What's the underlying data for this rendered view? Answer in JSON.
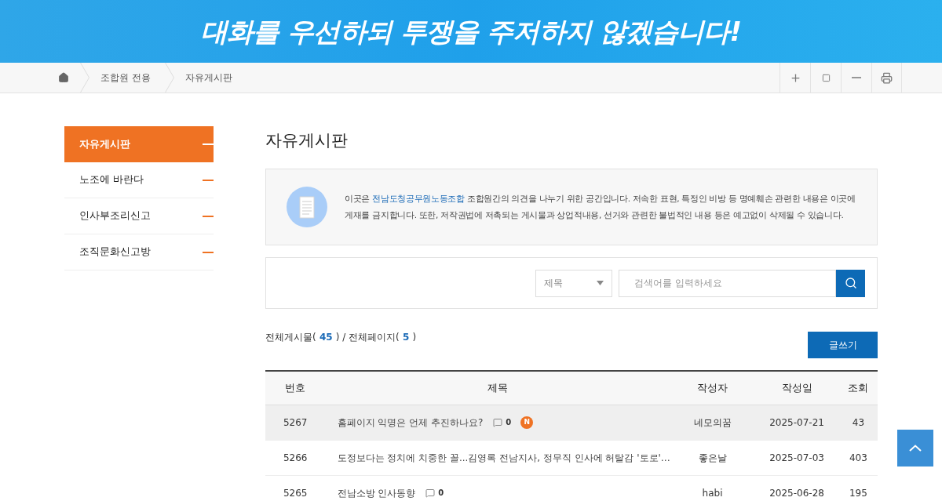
{
  "banner": {
    "slogan": "대화를 우선하되 투쟁을 주저하지 않겠습니다!"
  },
  "breadcrumb": [
    "조합원 전용",
    "자유게시판"
  ],
  "sidebar": {
    "items": [
      {
        "label": "자유게시판",
        "selected": true
      },
      {
        "label": "노조에 바란다",
        "selected": false
      },
      {
        "label": "인사부조리신고",
        "selected": false
      },
      {
        "label": "조직문화신고방",
        "selected": false
      }
    ]
  },
  "page_title": "자유게시판",
  "notice": "이곳은 **전남도청공무원노동조합** 조합원간의 의견을 나누기 위한 공간입니다. 저속한 표현, 특정인 비방 등 명예훼손 관련한 내용은 이곳에 게재를 금지합니다. 또한, 저작권법에 저촉되는 게시물과 상업적내용, 선거와 관련한 불법적인 내용 등은 예고없이 삭제될 수 있습니다.",
  "search": {
    "scope": "제목",
    "placeholder": "검색어를 입력하세요"
  },
  "totals": {
    "posts_label": "전체게시물(",
    "posts": "45",
    "pages_label": ") / 전체페이지(",
    "pages": "5",
    "close": ")"
  },
  "write_button": "글쓰기",
  "table": {
    "columns": [
      "번호",
      "제목",
      "작성자",
      "작성일",
      "조회"
    ],
    "rows": [
      {
        "number": "5267",
        "title": "홈페이지 익명은 언제 추진하나요?",
        "comments": "0",
        "new_badge": "N",
        "author": "네모의꿈",
        "date": "2025-07-21",
        "views": "43",
        "selected": true
      },
      {
        "number": "5266",
        "title": "도정보다는 정치에 치중한 꼴...김영록 전남지사, 정무직 인사에 허탈감 '토로'…",
        "author": "좋은날",
        "date": "2025-07-03",
        "views": "403",
        "selected": false
      },
      {
        "number": "5265",
        "title": "전남소방 인사동향",
        "comments": "0",
        "author": "habi",
        "date": "2025-06-28",
        "views": "195",
        "selected": false
      }
    ]
  }
}
